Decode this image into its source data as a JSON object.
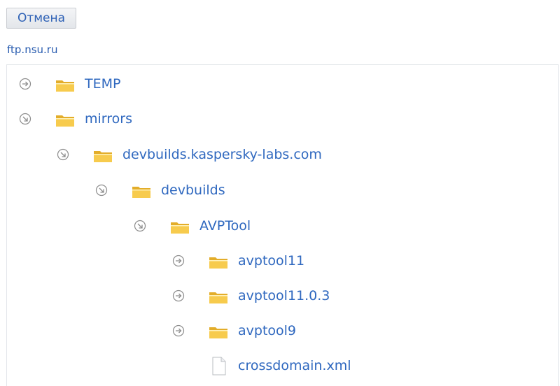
{
  "toolbar": {
    "cancel_label": "Отмена"
  },
  "host": {
    "label": "ftp.nsu.ru"
  },
  "tree": {
    "items": [
      {
        "label": "TEMP",
        "type": "folder",
        "state": "collapsed"
      },
      {
        "label": "mirrors",
        "type": "folder",
        "state": "expanded"
      },
      {
        "label": "devbuilds.kaspersky-labs.com",
        "type": "folder",
        "state": "expanded"
      },
      {
        "label": "devbuilds",
        "type": "folder",
        "state": "expanded"
      },
      {
        "label": "AVPTool",
        "type": "folder",
        "state": "expanded"
      },
      {
        "label": "avptool11",
        "type": "folder",
        "state": "collapsed"
      },
      {
        "label": "avptool11.0.3",
        "type": "folder",
        "state": "collapsed"
      },
      {
        "label": "avptool9",
        "type": "folder",
        "state": "collapsed"
      },
      {
        "label": "crossdomain.xml",
        "type": "file",
        "state": "none"
      }
    ]
  },
  "colors": {
    "link": "#2f68bf",
    "folder": "#f5c542",
    "toggle": "#8c8c8c"
  }
}
